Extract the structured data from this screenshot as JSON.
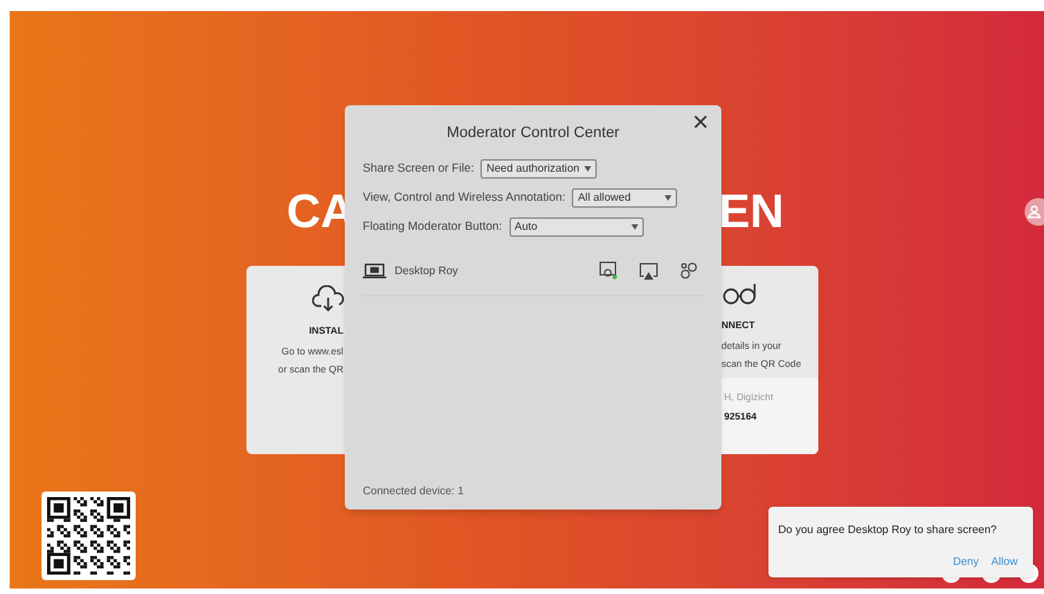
{
  "background": {
    "heading_left": "CA",
    "heading_right": "EN",
    "left_card": {
      "title": "INSTAL",
      "lines": [
        "Go to www.esl",
        "or scan the QR"
      ]
    },
    "right_card": {
      "title": "NNECT",
      "lines": [
        "details in your",
        "scan the QR Code"
      ],
      "footer": [
        "H, Digizicht",
        "925164"
      ]
    }
  },
  "dialog": {
    "title": "Moderator Control Center",
    "settings": [
      {
        "label": "Share Screen or File:",
        "value": "Need authorization"
      },
      {
        "label": "View, Control and Wireless Annotation:",
        "value": "All allowed"
      },
      {
        "label": "Floating Moderator Button:",
        "value": "Auto"
      }
    ],
    "devices": [
      {
        "name": "Desktop Roy"
      }
    ],
    "status": "Connected device: 1"
  },
  "notification": {
    "message": "Do you agree Desktop Roy to share screen?",
    "actions": [
      "Deny",
      "Allow"
    ]
  }
}
